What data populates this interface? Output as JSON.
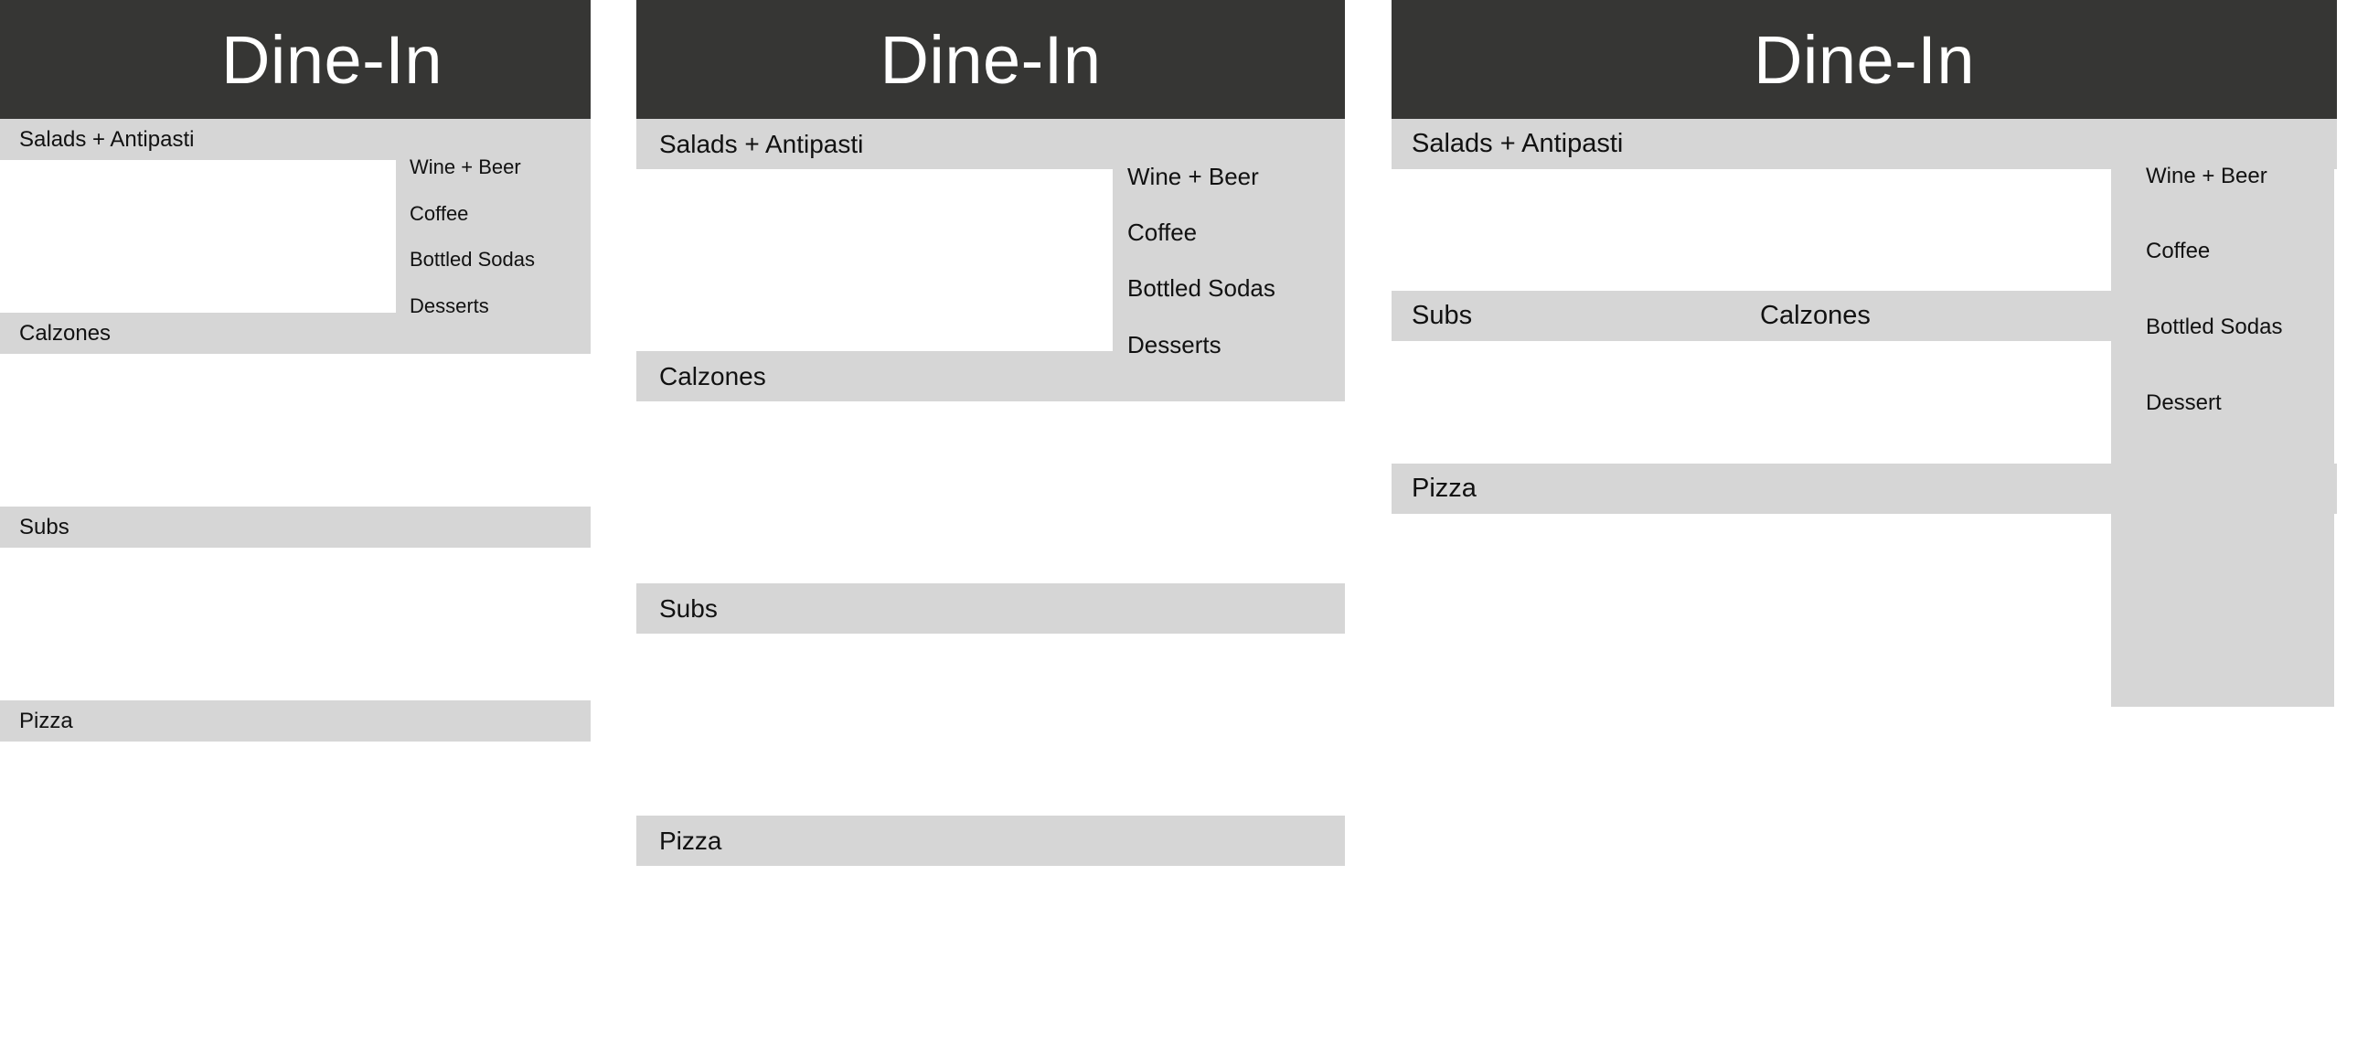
{
  "panels": [
    {
      "header": "Dine-In",
      "sections": [
        "Salads + Antipasti",
        "Calzones",
        "Subs",
        "Pizza"
      ],
      "sidebar": [
        "Wine + Beer",
        "Coffee",
        "Bottled Sodas",
        "Desserts"
      ]
    },
    {
      "header": "Dine-In",
      "sections": [
        "Salads + Antipasti",
        "Calzones",
        "Subs",
        "Pizza"
      ],
      "sidebar": [
        "Wine + Beer",
        "Coffee",
        "Bottled Sodas",
        "Desserts"
      ]
    },
    {
      "header": "Dine-In",
      "sections": [
        "Salads + Antipasti",
        "Subs",
        "Calzones",
        "Pizza"
      ],
      "sidebar": [
        "Wine + Beer",
        "Coffee",
        "Bottled Sodas",
        "Dessert"
      ]
    }
  ],
  "colors": {
    "header_bg": "#363634",
    "header_text": "#ffffff",
    "bar_bg": "#d6d6d6"
  }
}
